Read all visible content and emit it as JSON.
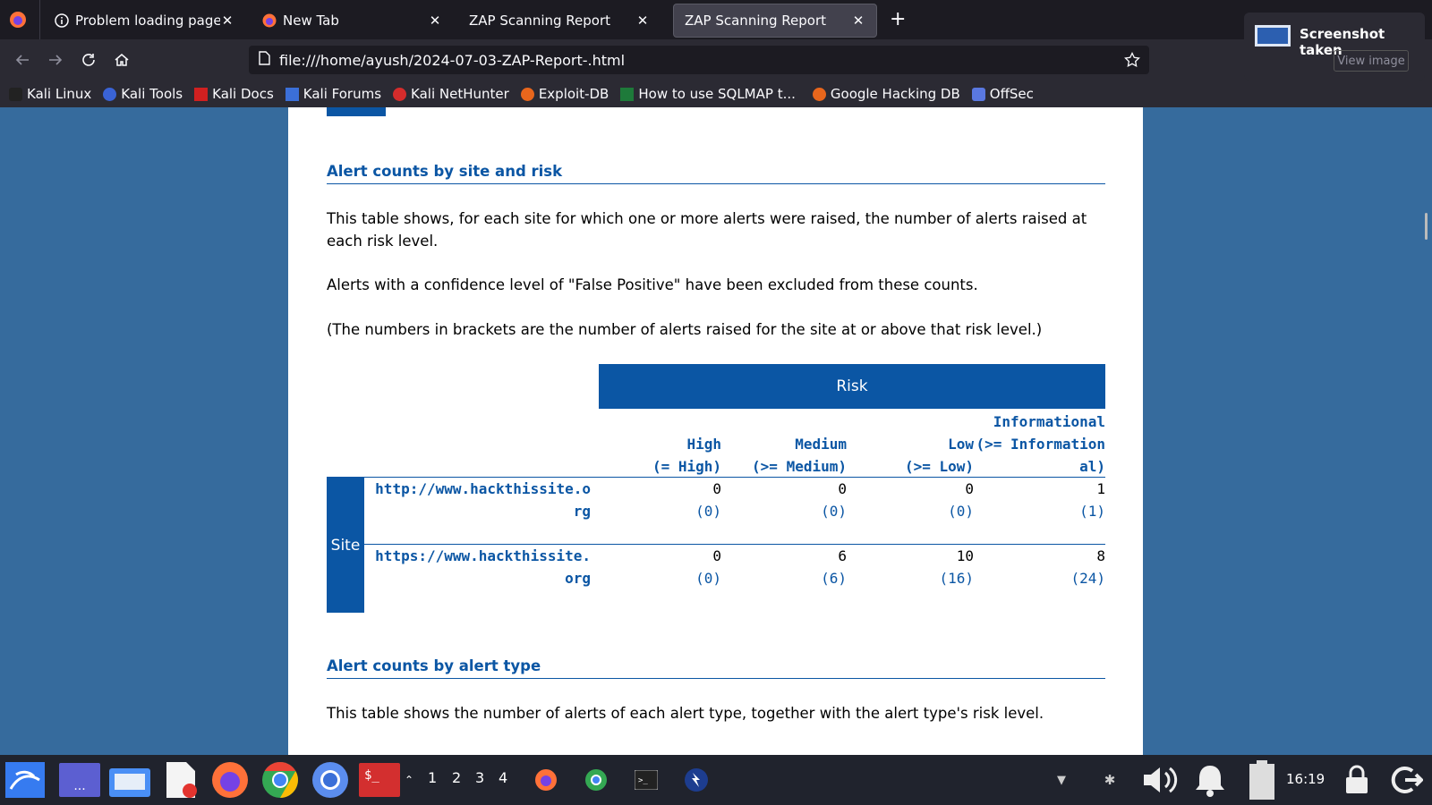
{
  "browser": {
    "tabs": [
      {
        "title": "Problem loading page",
        "icon": "info-icon",
        "active": false
      },
      {
        "title": "New Tab",
        "icon": "firefox-icon",
        "active": false
      },
      {
        "title": "ZAP Scanning Report",
        "icon": "",
        "active": false
      },
      {
        "title": "ZAP Scanning Report",
        "icon": "",
        "active": true
      }
    ],
    "url": "file:///home/ayush/2024-07-03-ZAP-Report-.html",
    "bookmarks": [
      "Kali Linux",
      "Kali Tools",
      "Kali Docs",
      "Kali Forums",
      "Kali NetHunter",
      "Exploit-DB",
      "How to use SQLMAP t...",
      "Google Hacking DB",
      "OffSec"
    ]
  },
  "notification": {
    "title": "Screenshot taken",
    "button": "View image"
  },
  "report": {
    "section1": {
      "title": "Alert counts by site and risk",
      "para1": "This table shows, for each site for which one or more alerts were raised, the number of alerts raised at each risk level.",
      "para2": "Alerts with a confidence level of \"False Positive\" have been excluded from these counts.",
      "para3": "(The numbers in brackets are the number of alerts raised for the site at or above that risk level.)"
    },
    "table": {
      "risk_header": "Risk",
      "site_label": "Site",
      "columns": [
        {
          "name": "High",
          "sub": "(= High)"
        },
        {
          "name": "Medium",
          "sub": "(>= Medium)"
        },
        {
          "name": "Low",
          "sub": "(>= Low)"
        },
        {
          "name": "Informational",
          "sub": "(>= Informational)"
        }
      ],
      "rows": [
        {
          "site": "http://www.hackthissite.org",
          "counts": [
            "0",
            "0",
            "0",
            "1"
          ],
          "cumulative": [
            "(0)",
            "(0)",
            "(0)",
            "(1)"
          ]
        },
        {
          "site": "https://www.hackthissite.org",
          "counts": [
            "0",
            "6",
            "10",
            "8"
          ],
          "cumulative": [
            "(0)",
            "(6)",
            "(16)",
            "(24)"
          ]
        }
      ]
    },
    "section2": {
      "title": "Alert counts by alert type",
      "para1": "This table shows the number of alerts of each alert type, together with the alert type's risk level."
    }
  },
  "taskbar": {
    "workspaces": [
      "1",
      "2",
      "3",
      "4"
    ],
    "clock": "16:19"
  },
  "colors": {
    "accent": "#0b56a4",
    "page_bg": "#366b9d",
    "chrome_dark": "#1c1b22",
    "chrome": "#2b2a33"
  }
}
